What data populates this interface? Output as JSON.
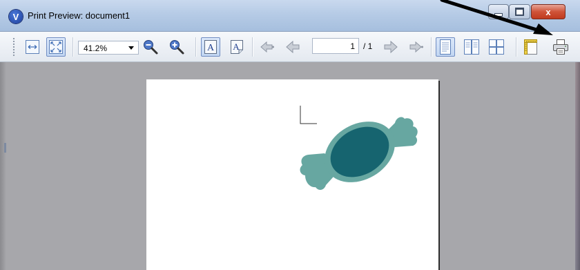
{
  "window": {
    "logo_letter": "V",
    "title": "Print Preview: document1",
    "close_glyph": "x"
  },
  "toolbar": {
    "zoom_value": "41.2%",
    "page_number": "1",
    "page_total": "/ 1",
    "buttons": [
      {
        "name": "page-width-button",
        "icon": "fit-width-icon"
      },
      {
        "name": "whole-page-button",
        "icon": "fit-page-icon",
        "pressed": true
      },
      {
        "name": "zoom-out-button",
        "icon": "zoom-out-icon"
      },
      {
        "name": "zoom-in-button",
        "icon": "zoom-in-icon"
      },
      {
        "name": "text-view-button",
        "icon": "text-a-icon",
        "pressed": true
      },
      {
        "name": "text-format-button",
        "icon": "text-a-page-icon"
      },
      {
        "name": "first-page-button",
        "icon": "first-page-arrow-icon"
      },
      {
        "name": "previous-page-button",
        "icon": "previous-page-arrow-icon"
      },
      {
        "name": "next-page-button",
        "icon": "next-page-arrow-icon"
      },
      {
        "name": "last-page-button",
        "icon": "last-page-arrow-icon"
      },
      {
        "name": "single-page-button",
        "icon": "single-page-icon",
        "pressed": true
      },
      {
        "name": "two-pages-button",
        "icon": "two-pages-icon"
      },
      {
        "name": "multiple-pages-button",
        "icon": "four-pages-icon"
      },
      {
        "name": "page-setup-button",
        "icon": "page-setup-ruler-icon"
      },
      {
        "name": "print-button",
        "icon": "printer-icon"
      }
    ]
  },
  "document": {
    "shape": "candy",
    "colors": {
      "wrapper": "#67a7a1",
      "candy_center": "#16646f"
    }
  },
  "annotation": {
    "target": "print-button",
    "color": "#000000"
  }
}
